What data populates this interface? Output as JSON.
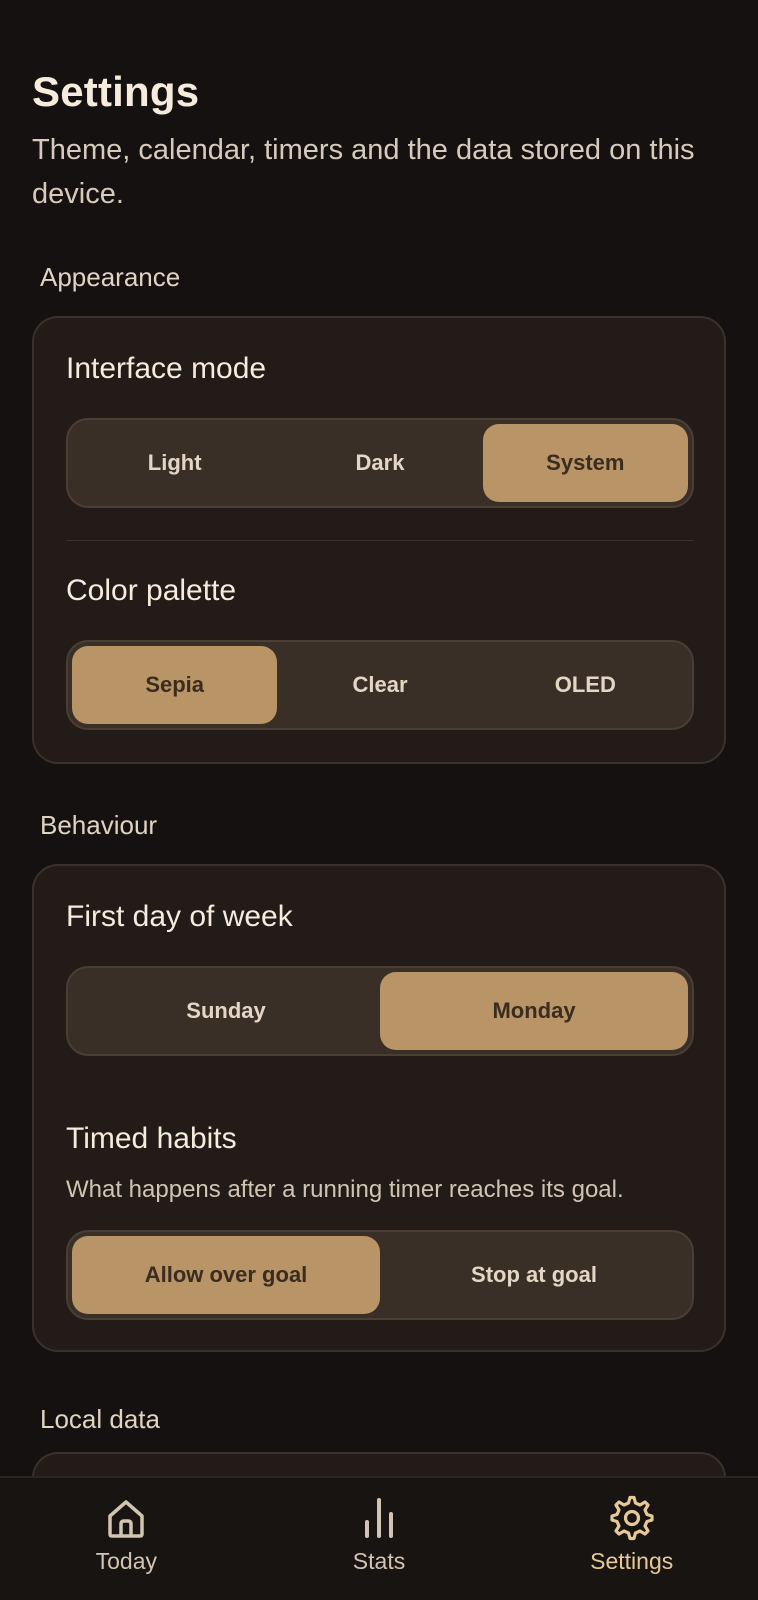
{
  "header": {
    "title": "Settings",
    "subtitle": "Theme, calendar, timers and the data stored on this device."
  },
  "sections": {
    "appearance": {
      "label": "Appearance",
      "interface_mode": {
        "title": "Interface mode",
        "options": [
          "Light",
          "Dark",
          "System"
        ],
        "selected": "System"
      },
      "color_palette": {
        "title": "Color palette",
        "options": [
          "Sepia",
          "Clear",
          "OLED"
        ],
        "selected": "Sepia"
      }
    },
    "behaviour": {
      "label": "Behaviour",
      "first_day": {
        "title": "First day of week",
        "options": [
          "Sunday",
          "Monday"
        ],
        "selected": "Monday"
      },
      "timed_habits": {
        "title": "Timed habits",
        "description": "What happens after a running timer reaches its goal.",
        "options": [
          "Allow over goal",
          "Stop at goal"
        ],
        "selected": "Allow over goal"
      }
    },
    "local_data": {
      "label": "Local data"
    }
  },
  "nav": {
    "items": [
      {
        "label": "Today",
        "icon": "home-icon",
        "active": false
      },
      {
        "label": "Stats",
        "icon": "stats-icon",
        "active": false
      },
      {
        "label": "Settings",
        "icon": "gear-icon",
        "active": true
      }
    ]
  },
  "colors": {
    "background": "#141110",
    "card": "#221b17",
    "accent": "#b89466",
    "accent_text": "#e7c998"
  }
}
